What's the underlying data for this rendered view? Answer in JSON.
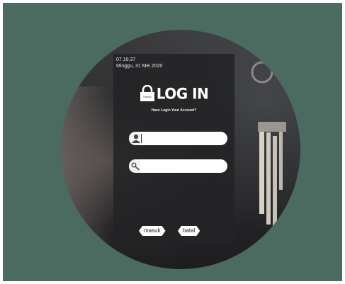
{
  "panel": {
    "time": "07.10.37",
    "date": "Minggu, 31 Mei 2020"
  },
  "logo": {
    "lock_label": "Padlock",
    "title": "LOG IN"
  },
  "subtitle": "Have Login Your Account?",
  "username_field": {
    "value": "",
    "icon": "user-icon"
  },
  "password_field": {
    "value": "",
    "icon": "key-icon"
  },
  "buttons": {
    "login": "masuk",
    "cancel": "batal"
  },
  "colors": {
    "background": "#4b6b61",
    "panel": "#232326",
    "text": "#ffffff"
  }
}
